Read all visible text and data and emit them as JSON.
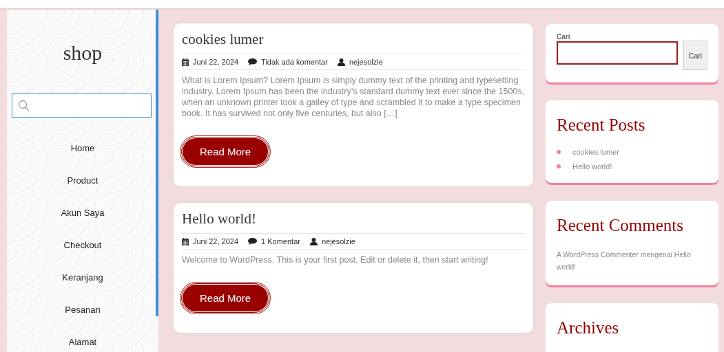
{
  "site": {
    "title": "shop"
  },
  "sidebar": {
    "menu": [
      {
        "label": "Home"
      },
      {
        "label": "Product"
      },
      {
        "label": "Akun Saya"
      },
      {
        "label": "Checkout"
      },
      {
        "label": "Keranjang"
      },
      {
        "label": "Pesanan"
      },
      {
        "label": "Alamat"
      }
    ]
  },
  "posts": [
    {
      "title": "cookies lumer",
      "date": "Juni 22, 2024",
      "comments": "Tidak ada komentar",
      "author": "nejesolzie",
      "excerpt": "What is Lorem Ipsum? Lorem Ipsum is simply dummy text of the printing and typesetting industry. Lorem Ipsum has been the industry’s standard dummy text ever since the 1500s, when an unknown printer took a galley of type and scrambled it to make a type specimen book. It has survived not only five centuries, but also […]",
      "button": "Read More"
    },
    {
      "title": "Hello world!",
      "date": "Juni 22, 2024",
      "comments": "1 Komentar",
      "author": "nejesolzie",
      "excerpt": "Welcome to WordPress. This is your first post. Edit or delete it, then start writing!",
      "button": "Read More"
    }
  ],
  "widgets": [
    {
      "kind": "search",
      "label": "Cari",
      "button": "Cari"
    },
    {
      "kind": "list",
      "title": "Recent Posts",
      "items": [
        "cookies lumer",
        "Hello world!"
      ]
    },
    {
      "kind": "text",
      "title": "Recent Comments",
      "text": "A WordPress Commenter mengenai Hello world!"
    },
    {
      "kind": "list",
      "title": "Archives"
    }
  ]
}
